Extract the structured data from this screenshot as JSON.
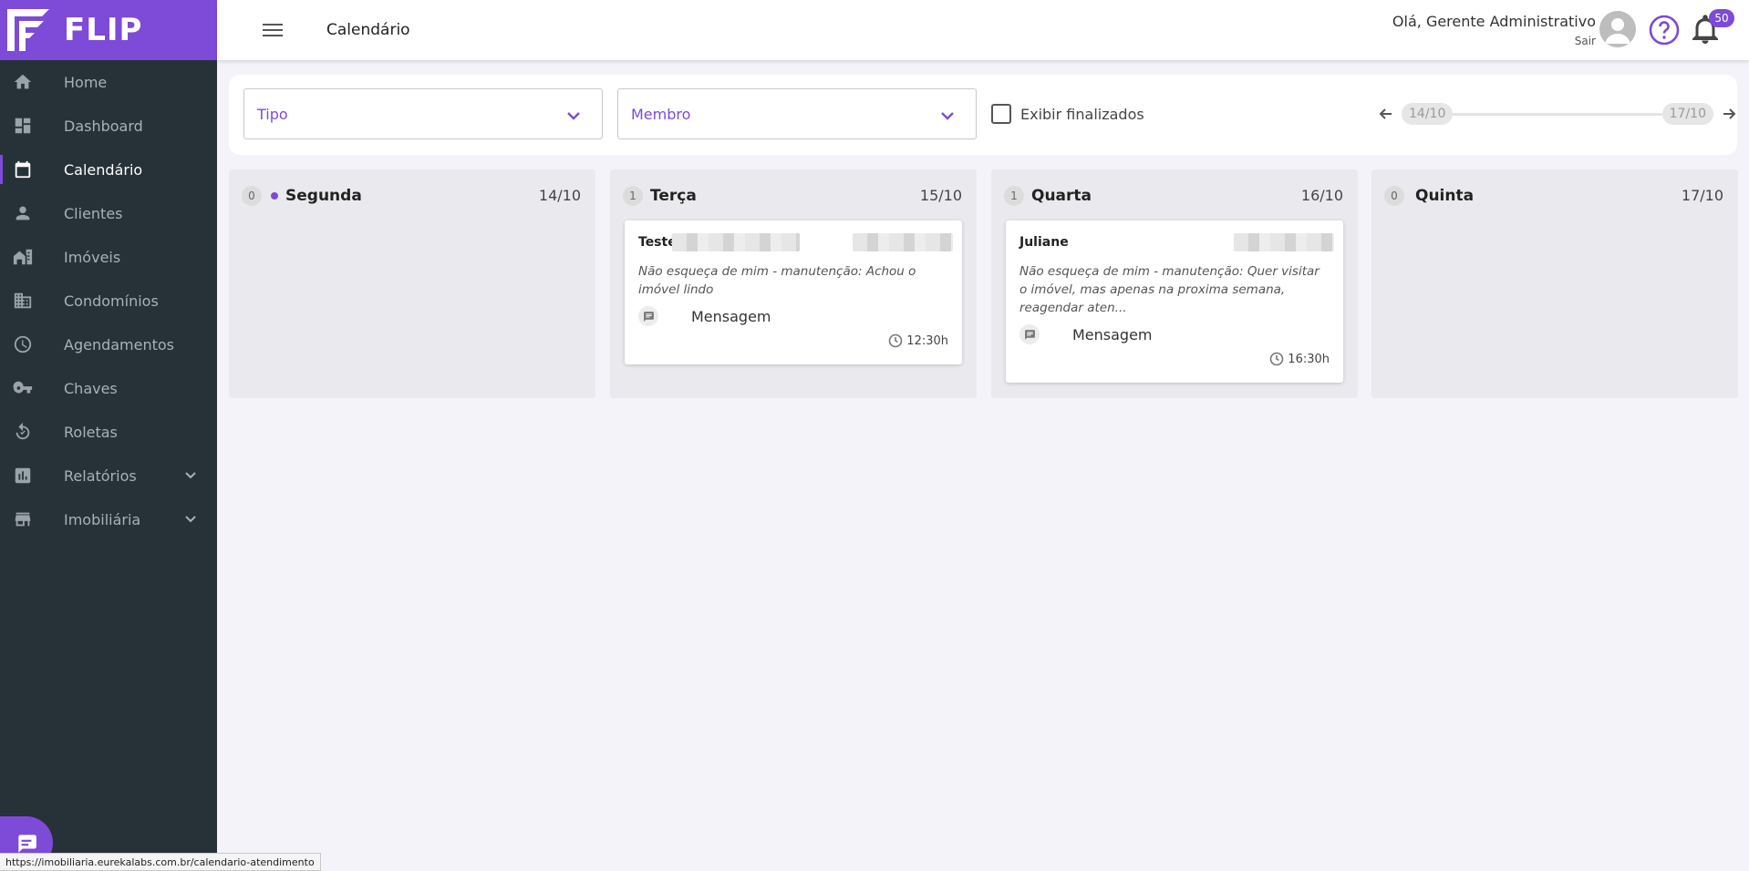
{
  "app": {
    "brand": "FLIP",
    "accent_color": "#7e4ad8",
    "sidebar_color": "#263238"
  },
  "sidebar": {
    "items": [
      {
        "label": "Home",
        "icon": "home-icon",
        "active": false
      },
      {
        "label": "Dashboard",
        "icon": "dashboard-icon",
        "active": false
      },
      {
        "label": "Calendário",
        "icon": "calendar-icon",
        "active": true
      },
      {
        "label": "Clientes",
        "icon": "person-icon",
        "active": false
      },
      {
        "label": "Imóveis",
        "icon": "house-icon",
        "active": false
      },
      {
        "label": "Condomínios",
        "icon": "building-icon",
        "active": false
      },
      {
        "label": "Agendamentos",
        "icon": "clock-icon",
        "active": false
      },
      {
        "label": "Chaves",
        "icon": "key-icon",
        "active": false
      },
      {
        "label": "Roletas",
        "icon": "rotate-icon",
        "active": false
      },
      {
        "label": "Relatórios",
        "icon": "bar-chart-icon",
        "active": false,
        "expandable": true
      },
      {
        "label": "Imobiliária",
        "icon": "store-icon",
        "active": false,
        "expandable": true
      }
    ]
  },
  "header": {
    "title": "Calendário",
    "greeting": "Olá, Gerente Administrativo",
    "logout": "Sair",
    "notification_count": "50"
  },
  "filters": {
    "tipo_placeholder": "Tipo",
    "membro_placeholder": "Membro",
    "show_finished_label": "Exibir finalizados",
    "show_finished_checked": false,
    "range_start": "14/10",
    "range_end": "17/10"
  },
  "columns": [
    {
      "count": "0",
      "day": "Segunda",
      "date": "14/10",
      "today": true,
      "cards": []
    },
    {
      "count": "1",
      "day": "Terça",
      "date": "15/10",
      "today": false,
      "cards": [
        {
          "title": "Teste",
          "description": "Não esqueça de mim - manutenção: Achou o imóvel lindo",
          "type": "Mensagem",
          "time": "12:30h"
        }
      ]
    },
    {
      "count": "1",
      "day": "Quarta",
      "date": "16/10",
      "today": false,
      "cards": [
        {
          "title": "Juliane",
          "description": "Não esqueça de mim - manutenção: Quer visitar o imóvel, mas apenas na proxima semana, reagendar aten...",
          "type": "Mensagem",
          "time": "16:30h"
        }
      ]
    },
    {
      "count": "0",
      "day": "Quinta",
      "date": "17/10",
      "today": false,
      "cards": []
    }
  ],
  "status_bar": {
    "url": "https://imobiliaria.eurekalabs.com.br/calendario-atendimento"
  }
}
